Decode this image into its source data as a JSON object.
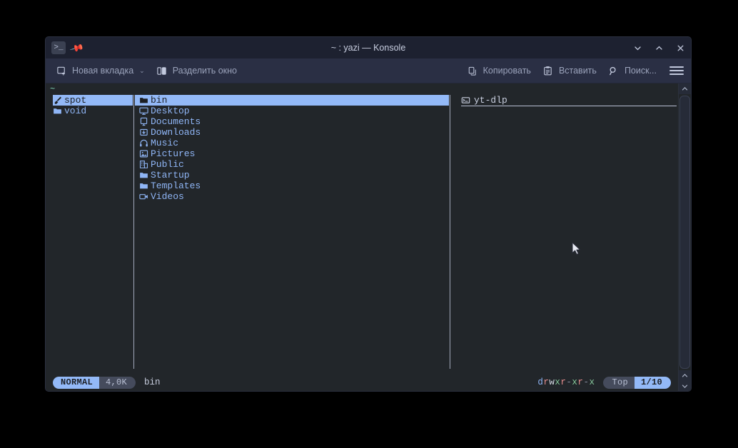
{
  "window": {
    "title": "~ : yazi — Konsole",
    "app_icon": "terminal-prompt-icon",
    "pin_icon": "pin-icon",
    "controls": {
      "minimize": "chevron-down-icon",
      "maximize": "chevron-up-icon",
      "close": "close-icon"
    }
  },
  "toolbar": {
    "new_tab_label": "Новая вкладка",
    "new_tab_caret": "⌄",
    "split_view_label": "Разделить окно",
    "copy_label": "Копировать",
    "paste_label": "Вставить",
    "find_label": "Поиск...",
    "menu_icon": "hamburger-menu-icon"
  },
  "yazi": {
    "tab_label": "~",
    "parent_pane": {
      "items": [
        {
          "name": "spot",
          "icon": "paintbrush-icon",
          "selected": true
        },
        {
          "name": "void",
          "icon": "folder-icon",
          "selected": false
        }
      ]
    },
    "current_pane": {
      "items": [
        {
          "name": "bin",
          "icon": "folder-icon",
          "selected": true
        },
        {
          "name": "Desktop",
          "icon": "monitor-icon",
          "selected": false
        },
        {
          "name": "Documents",
          "icon": "document-icon",
          "selected": false
        },
        {
          "name": "Downloads",
          "icon": "download-icon",
          "selected": false
        },
        {
          "name": "Music",
          "icon": "headphones-icon",
          "selected": false
        },
        {
          "name": "Pictures",
          "icon": "image-icon",
          "selected": false
        },
        {
          "name": "Public",
          "icon": "building-icon",
          "selected": false
        },
        {
          "name": "Startup",
          "icon": "folder-icon",
          "selected": false
        },
        {
          "name": "Templates",
          "icon": "folder-icon",
          "selected": false
        },
        {
          "name": "Videos",
          "icon": "video-camera-icon",
          "selected": false
        }
      ]
    },
    "preview_pane": {
      "items": [
        {
          "name": "yt-dlp",
          "icon": "executable-icon"
        }
      ]
    },
    "status": {
      "mode": "NORMAL",
      "size": "4,0K",
      "filename": "bin",
      "permissions": "drwxr-xr-x",
      "scroll_position": "Top",
      "index": "1/10"
    }
  },
  "colors": {
    "accent_blue": "#93b9f7",
    "terminal_bg": "#22262a",
    "titlebar_bg": "#1d2130",
    "toolbar_bg": "#2a2f44",
    "file_text": "#8fb5f5",
    "tab_green": "#7fd6b5"
  }
}
